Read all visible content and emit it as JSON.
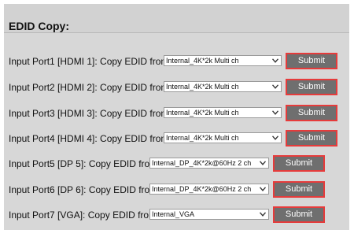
{
  "panel": {
    "title": "EDID Copy:"
  },
  "rows": [
    {
      "label": "Input Port1 [HDMI 1]: Copy EDID from",
      "selected": "Internal_4K*2k Multi ch",
      "submit_label": "Submit"
    },
    {
      "label": "Input Port2 [HDMI 2]: Copy EDID from",
      "selected": "Internal_4K*2k Multi ch",
      "submit_label": "Submit"
    },
    {
      "label": "Input Port3 [HDMI 3]: Copy EDID from",
      "selected": "Internal_4K*2k Multi ch",
      "submit_label": "Submit"
    },
    {
      "label": "Input Port4 [HDMI 4]: Copy EDID from",
      "selected": "Internal_4K*2k Multi ch",
      "submit_label": "Submit"
    },
    {
      "label": "Input Port5 [DP 5]: Copy EDID from",
      "selected": "Internal_DP_4K*2k@60Hz 2 ch",
      "submit_label": "Submit"
    },
    {
      "label": "Input Port6 [DP 6]: Copy EDID from",
      "selected": "Internal_DP_4K*2k@60Hz 2 ch",
      "submit_label": "Submit"
    },
    {
      "label": "Input Port7 [VGA]: Copy EDID from",
      "selected": "Internal_VGA",
      "submit_label": "Submit"
    }
  ],
  "colors": {
    "panel_bg": "#d7d7d7",
    "button_bg": "#6f6f6f",
    "button_border": "#e63b3b"
  }
}
